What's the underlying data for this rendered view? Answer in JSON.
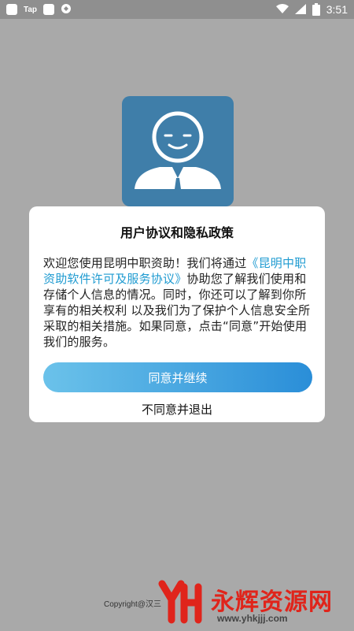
{
  "status_bar": {
    "app_label": "Tap",
    "battery_level": "8",
    "time": "3:51",
    "icons": [
      "app-square-icon",
      "notification-square-icon",
      "sync-icon",
      "wifi-icon",
      "signal-icon",
      "battery-icon"
    ]
  },
  "logo": {
    "icon": "smiling-person-icon"
  },
  "dialog": {
    "title": "用户协议和隐私政策",
    "body_intro": "欢迎您使用昆明中职资助！我们将通过",
    "body_link": "《昆明中职资助软件许可及服务协议》",
    "body_rest": "协助您了解我们使用和存储个人信息的情况。同时，你还可以了解到你所享有的相关权利 以及我们为了保护个人信息安全所采取的相关措施。如果同意，点击“同意”开始使用我们的服务。",
    "agree_label": "同意并继续",
    "disagree_label": "不同意并退出"
  },
  "footer": {
    "copyright": "Copyright@汉三"
  },
  "watermark": {
    "text": "永辉资源网",
    "url": "www.yhkjjj.com"
  },
  "colors": {
    "background": "#a9a9a9",
    "logo": "#3f7ea9",
    "link": "#1f9bd1",
    "watermark": "#e0241b"
  }
}
